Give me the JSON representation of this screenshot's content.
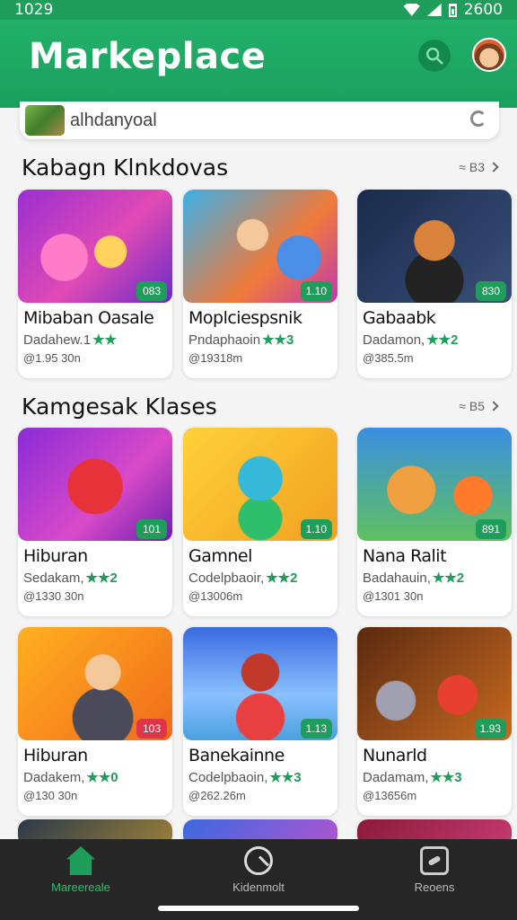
{
  "status_bar": {
    "time_left": "1029",
    "time_right": "2600"
  },
  "app_bar": {
    "title": "Markeplace"
  },
  "search": {
    "value": "alhdanyoal"
  },
  "sections": [
    {
      "title": "Kabagn Klnkdovas",
      "more": "≈ B3",
      "cards": [
        {
          "title": "Mibaban Oasale",
          "sub": "Dadahew.1",
          "rating": "★★",
          "size": "@1.95 30n",
          "badge": "083"
        },
        {
          "title": "Moplciespsnik",
          "sub": "Pndaphaoin",
          "rating": "★★3",
          "size": "@19318m",
          "badge": "1.10"
        },
        {
          "title": "Gabaabk",
          "sub": "Dadamon,",
          "rating": "★★2",
          "size": "@385.5m",
          "badge": "830"
        }
      ]
    },
    {
      "title": "Kamgesak Klases",
      "more": "≈ B5",
      "cards": [
        {
          "title": "Hiburan",
          "sub": "Sedakam,",
          "rating": "★★2",
          "size": "@1330 30n",
          "badge": "101"
        },
        {
          "title": "Gamnel",
          "sub": "Codelpbaoir,",
          "rating": "★★2",
          "size": "@13006m",
          "badge": "1.10"
        },
        {
          "title": "Nana Ralit",
          "sub": "Badahauin,",
          "rating": "★★2",
          "size": "@1301 30n",
          "badge": "891"
        }
      ]
    },
    {
      "title": "",
      "more": "",
      "cards": [
        {
          "title": "Hiburan",
          "sub": "Dadakem,",
          "rating": "★★0",
          "size": "@130 30n",
          "badge": "103"
        },
        {
          "title": "Banekainne",
          "sub": "Codelpbaoin,",
          "rating": "★★3",
          "size": "@262.26m",
          "badge": "1.13"
        },
        {
          "title": "Nunarld",
          "sub": "Dadamam,",
          "rating": "★★3",
          "size": "@13656m",
          "badge": "1.93"
        }
      ]
    }
  ],
  "bottom_nav": [
    {
      "label": "Mareereale",
      "icon": "home-icon",
      "active": true
    },
    {
      "label": "Kidenmolt",
      "icon": "explore-icon",
      "active": false
    },
    {
      "label": "Reoens",
      "icon": "games-icon",
      "active": false
    }
  ],
  "colors": {
    "accent": "#1f9d5b",
    "badge_red": "#e0344a",
    "nav_bg": "#262626"
  }
}
